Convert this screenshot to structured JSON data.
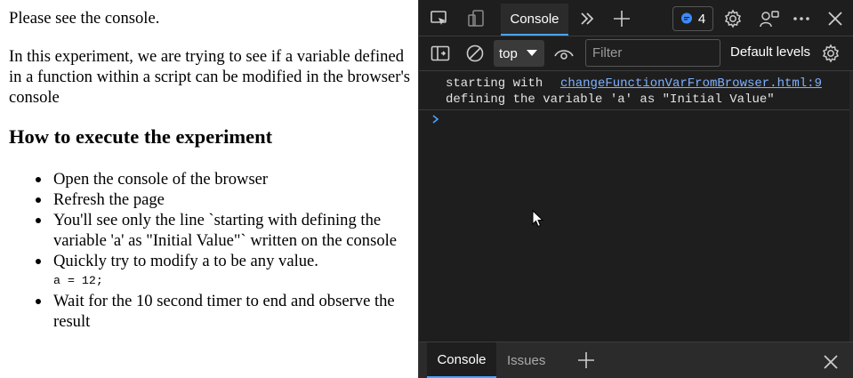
{
  "page": {
    "intro": "Please see the console.",
    "description": "In this experiment, we are trying to see if a variable defined in a function within a script can be modified in the browser's console",
    "heading": "How to execute the experiment",
    "steps": [
      "Open the console of the browser",
      "Refresh the page",
      "You'll see only the line `starting with defining the variable 'a' as \"Initial Value\"` written on the console",
      "Quickly try to modify a to be any value.",
      "Wait for the 10 second timer to end and observe the result"
    ],
    "code_snippet": "a = 12;"
  },
  "devtools": {
    "topbar": {
      "console_tab": "Console",
      "message_count": "4"
    },
    "filterbar": {
      "context": "top",
      "filter_placeholder": "Filter",
      "default_levels": "Default levels"
    },
    "console": {
      "log_line_1": "starting with",
      "log_line_2": "defining the variable 'a' as \"Initial Value\"",
      "log_source": "changeFunctionVarFromBrowser.html:9"
    },
    "drawer": {
      "console_tab": "Console",
      "issues_tab": "Issues"
    }
  },
  "colors": {
    "devtools_bg": "#1e1e1e",
    "accent": "#4aa3ff",
    "link": "#7fb1ff"
  }
}
